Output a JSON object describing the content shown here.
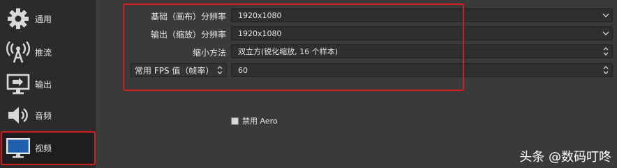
{
  "sidebar": {
    "items": [
      {
        "label": "通用",
        "icon": "gear-icon"
      },
      {
        "label": "推流",
        "icon": "broadcast-icon"
      },
      {
        "label": "输出",
        "icon": "monitor-output-icon"
      },
      {
        "label": "音频",
        "icon": "speaker-icon"
      },
      {
        "label": "视频",
        "icon": "monitor-icon",
        "active": true
      }
    ]
  },
  "video": {
    "base_resolution": {
      "label": "基础（画布）分辨率",
      "value": "1920x1080"
    },
    "output_resolution": {
      "label": "输出（缩放）分辨率",
      "value": "1920x1080"
    },
    "downscale_filter": {
      "label": "缩小方法",
      "value": "双立方(锐化缩放, 16 个样本)"
    },
    "fps": {
      "type_label": "常用 FPS 值（帧率）",
      "value": "60"
    },
    "disable_aero": {
      "label": "禁用 Aero",
      "checked": false
    }
  },
  "watermark": "头条 @数码叮咚",
  "colors": {
    "highlight": "#d31f1f",
    "panel": "#3a3a3a",
    "sidebar": "#2b2b2b"
  }
}
